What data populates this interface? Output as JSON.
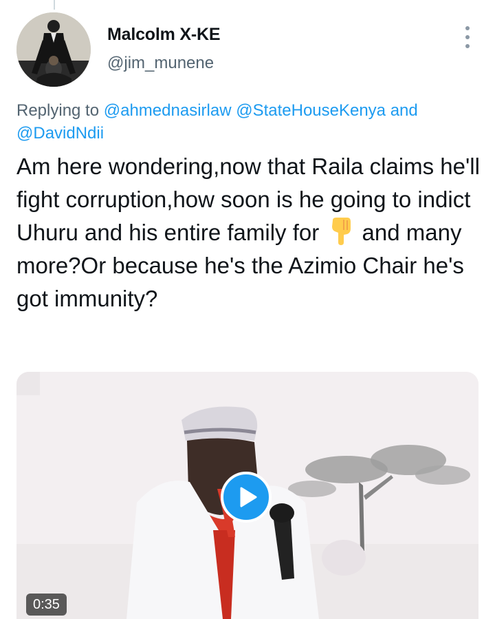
{
  "author": {
    "display_name": "Malcolm X-KE",
    "handle": "@jim_munene",
    "avatar_icon": "profile-photo"
  },
  "reply": {
    "prefix": "Replying to",
    "mentions": [
      "@ahmednasirlaw",
      "@StateHouseKenya"
    ],
    "conjunction": "and",
    "last_mention": "@DavidNdii"
  },
  "tweet": {
    "text_before_emoji": "Am here wondering,now that Raila claims he'll fight corruption,how soon is he going to indict Uhuru and his entire family for",
    "emoji_icon": "backhand-index-pointing-down-icon",
    "text_after_emoji": "and many more?Or because he's the Azimio Chair he's got immunity?"
  },
  "media": {
    "type": "video",
    "duration": "0:35",
    "play_icon": "play-icon"
  },
  "colors": {
    "accent": "#1d9bf0",
    "secondary_text": "#536471",
    "primary_text": "#0f1419"
  }
}
